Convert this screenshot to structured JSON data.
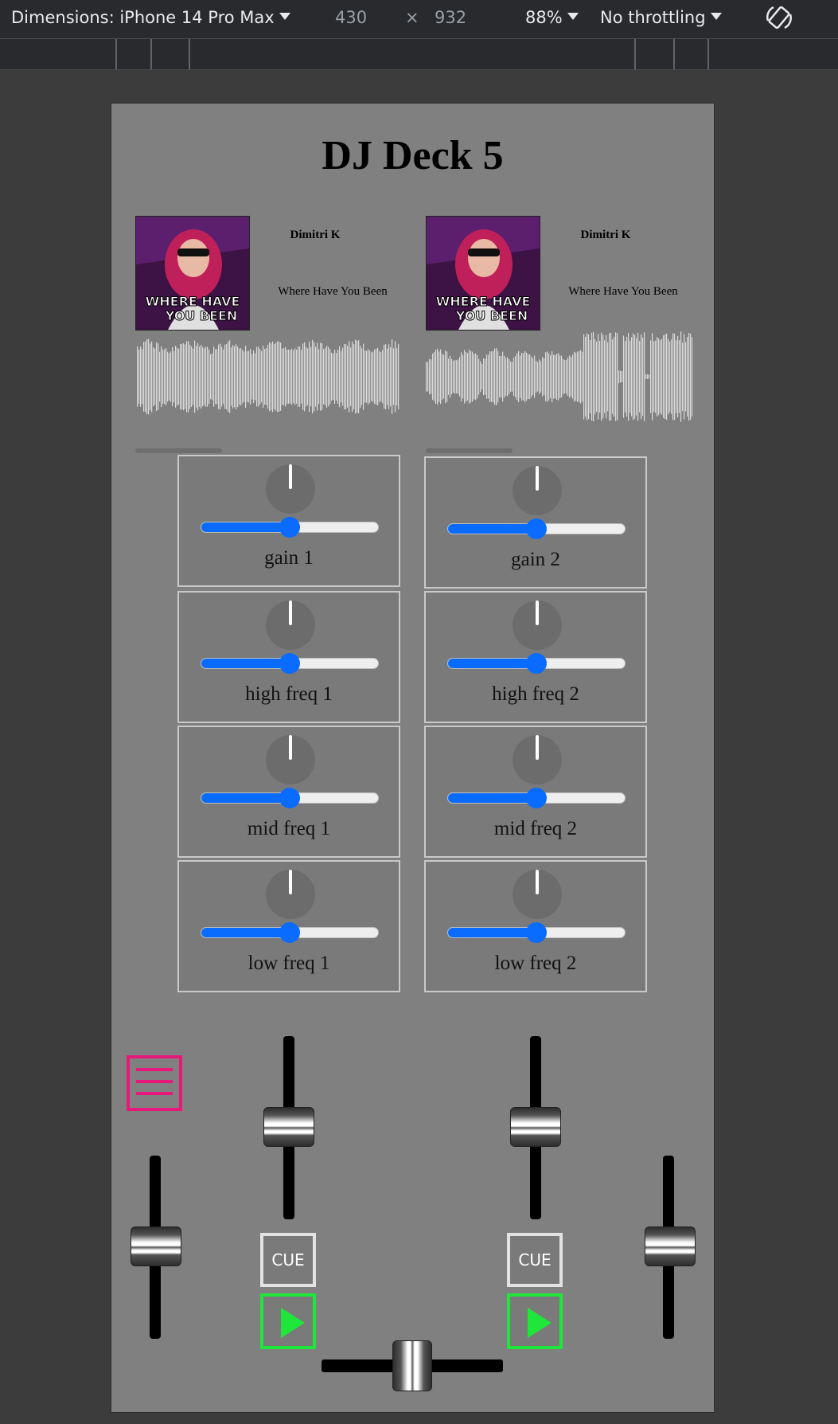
{
  "devtools": {
    "dimensions_label": "Dimensions: iPhone 14 Pro Max",
    "width": "430",
    "times": "×",
    "height": "932",
    "zoom": "88%",
    "throttling": "No throttling"
  },
  "app": {
    "title": "DJ Deck 5",
    "decks": [
      {
        "artist": "Dimitri K",
        "song": "Where Have You Been",
        "progress": 0.33
      },
      {
        "artist": "Dimitri K",
        "song": "Where Have You Been",
        "progress": 0.33
      }
    ],
    "knobs": {
      "left": [
        {
          "label": "gain 1",
          "value": 0.5
        },
        {
          "label": "high freq 1",
          "value": 0.5
        },
        {
          "label": "mid freq 1",
          "value": 0.5
        },
        {
          "label": "low freq 1",
          "value": 0.5
        }
      ],
      "right": [
        {
          "label": "gain 2",
          "value": 0.5
        },
        {
          "label": "high freq 2",
          "value": 0.5
        },
        {
          "label": "mid freq 2",
          "value": 0.5
        },
        {
          "label": "low freq 2",
          "value": 0.5
        }
      ]
    },
    "cue_label": "CUE",
    "colors": {
      "accent_blue": "#0a6cff",
      "play_green": "#1fe63a",
      "menu_pink": "#e6197a"
    }
  }
}
